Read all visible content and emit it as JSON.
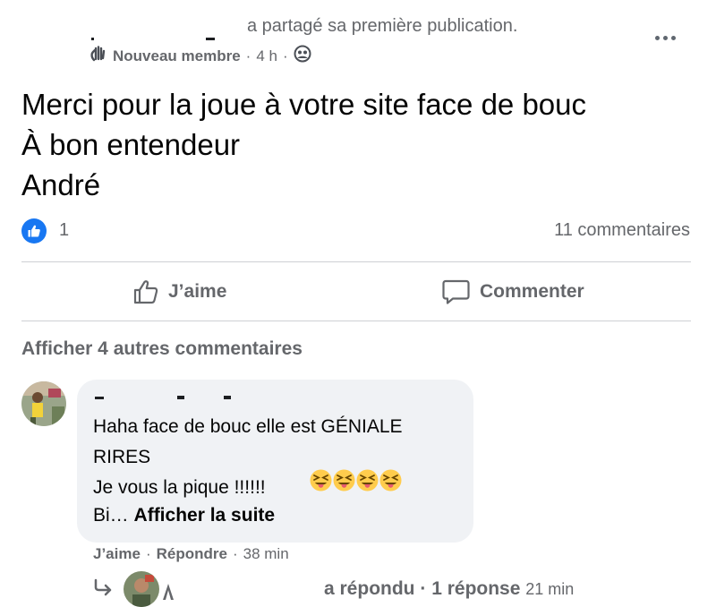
{
  "header": {
    "shared_text": "a partagé sa première publication.",
    "badge": "Nouveau membre",
    "time": "4 h",
    "separator": "·"
  },
  "post": {
    "text": "Merci pour la joue à votre site face de bouc\nÀ bon entendeur\nAndré"
  },
  "reactions": {
    "count": "1",
    "comments": "11 commentaires"
  },
  "actions": {
    "like": "J’aime",
    "comment": "Commenter"
  },
  "more_comments": "Afficher 4 autres commentaires",
  "comment": {
    "text": "Haha face de bouc elle est GÉNIALE\nRIRES\nJe vous la pique !!!!!!",
    "truncated": "Bi…",
    "see_more": "Afficher la suite",
    "like": "J’aime",
    "reply": "Répondre",
    "time": "38 min",
    "sep": "·",
    "emoji_count": 4
  },
  "reply": {
    "text_partial": "a répondu",
    "sep": "·",
    "count": "1 réponse",
    "time": "21 min"
  },
  "colors": {
    "facebook_blue": "#1877f2",
    "muted": "#65676b",
    "bubble": "#f0f2f5"
  }
}
